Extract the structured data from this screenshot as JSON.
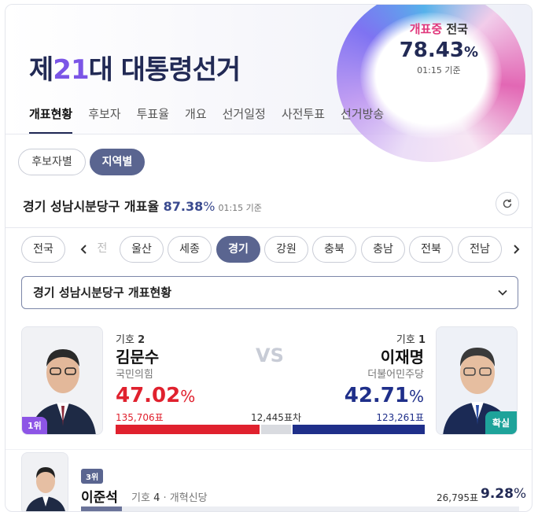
{
  "header": {
    "title_prefix": "제",
    "title_number": "21",
    "title_suffix": "대 대통령선거",
    "progress_label_hot": "개표중",
    "progress_label_rest": " 전국",
    "progress_value": "78.43",
    "progress_unit": "%",
    "progress_time": "01:15 기준"
  },
  "nav": {
    "tabs": [
      "개표현황",
      "후보자",
      "투표율",
      "개요",
      "선거일정",
      "사전투표",
      "선거방송"
    ]
  },
  "filters": {
    "by_candidate": "후보자별",
    "by_region": "지역별"
  },
  "region_summary": {
    "name": "경기 성남시분당구 개표율",
    "rate": "87.38",
    "unit": "%",
    "time": "01:15 기준"
  },
  "regions": {
    "nationwide": "전국",
    "faded": "전",
    "items": [
      "울산",
      "세종",
      "경기",
      "강원",
      "충북",
      "충남",
      "전북",
      "전남"
    ]
  },
  "select": {
    "value": "경기 성남시분당구 개표현황"
  },
  "candidates": {
    "left": {
      "rank": "1위",
      "number_label": "기호",
      "number": "2",
      "name": "김문수",
      "party": "국민의힘",
      "pct": "47.02",
      "pct_unit": "%",
      "votes": "135,706표",
      "color": "#e0212e",
      "share": 47.02
    },
    "right": {
      "badge": "확실",
      "number_label": "기호",
      "number": "1",
      "name": "이재명",
      "party": "더불어민주당",
      "pct": "42.71",
      "pct_unit": "%",
      "votes": "123,261표",
      "color": "#1f2f8a",
      "share": 42.71
    },
    "vs": "VS",
    "diff": "12,445표차",
    "third": {
      "rank": "3위",
      "name": "이준석",
      "number_label": "기호",
      "number": "4",
      "party": "개혁신당",
      "votes": "26,795표",
      "pct": "9.28",
      "pct_unit": "%",
      "share": 9.28
    }
  }
}
